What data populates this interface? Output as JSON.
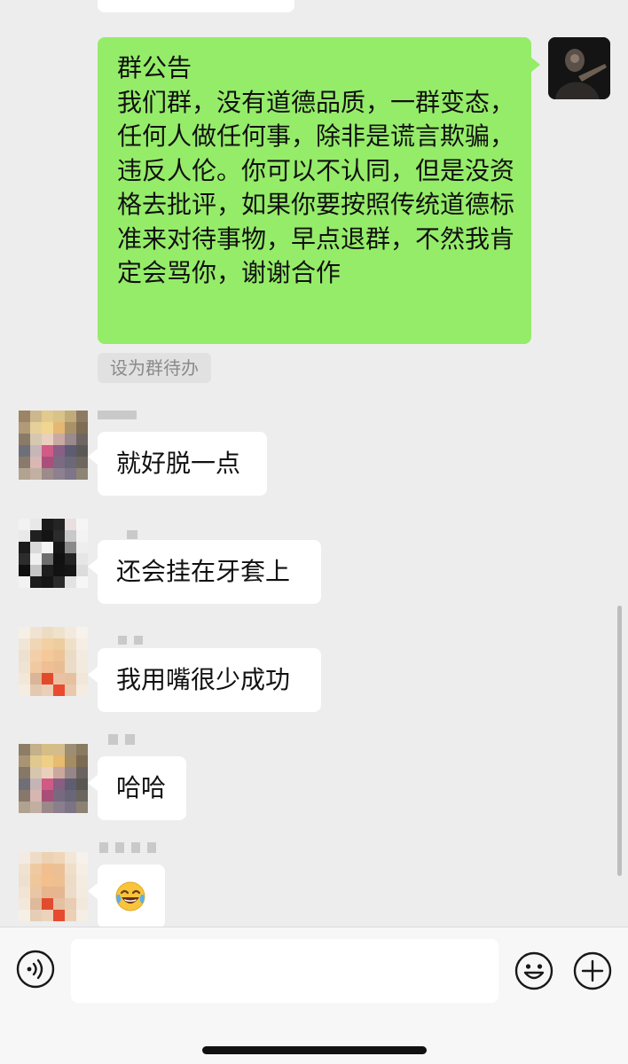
{
  "announcement": {
    "text": "群公告\n我们群，没有道德品质，一群变态，任何人做任何事，除非是谎言欺骗，违反人伦。你可以不认同，但是没资格去批评，如果你要按照传统道德标准来对待事物，早点退群，不然我肯定会骂你，谢谢合作",
    "todo_label": "设为群待办"
  },
  "messages": [
    {
      "text": "就好脱一点"
    },
    {
      "text": "还会挂在牙套上"
    },
    {
      "text": "我用嘴很少成功"
    },
    {
      "text": "哈哈"
    },
    {
      "text": "😂",
      "emoji_name": "face-with-tears-of-joy"
    }
  ],
  "input": {
    "value": "",
    "placeholder": ""
  },
  "icons": {
    "voice": "voice-icon",
    "emoji": "emoji-icon",
    "plus": "plus-icon"
  },
  "colors": {
    "background": "#ededed",
    "self_bubble": "#95ec69",
    "other_bubble": "#ffffff",
    "input_bar": "#f7f7f7"
  }
}
